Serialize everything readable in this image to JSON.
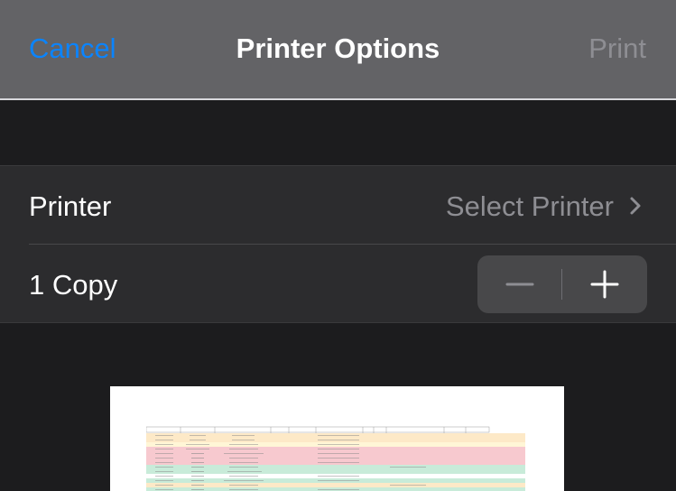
{
  "navbar": {
    "cancel_label": "Cancel",
    "title": "Printer Options",
    "print_label": "Print"
  },
  "printer_row": {
    "label": "Printer",
    "value": "Select Printer"
  },
  "copies_row": {
    "label": "1 Copy",
    "count": 1
  },
  "colors": {
    "accent": "#0a84ff",
    "nav_bg": "#636366",
    "cell_bg": "#2c2c2e",
    "background": "#1c1c1e",
    "secondary_text": "#8e8e93"
  }
}
